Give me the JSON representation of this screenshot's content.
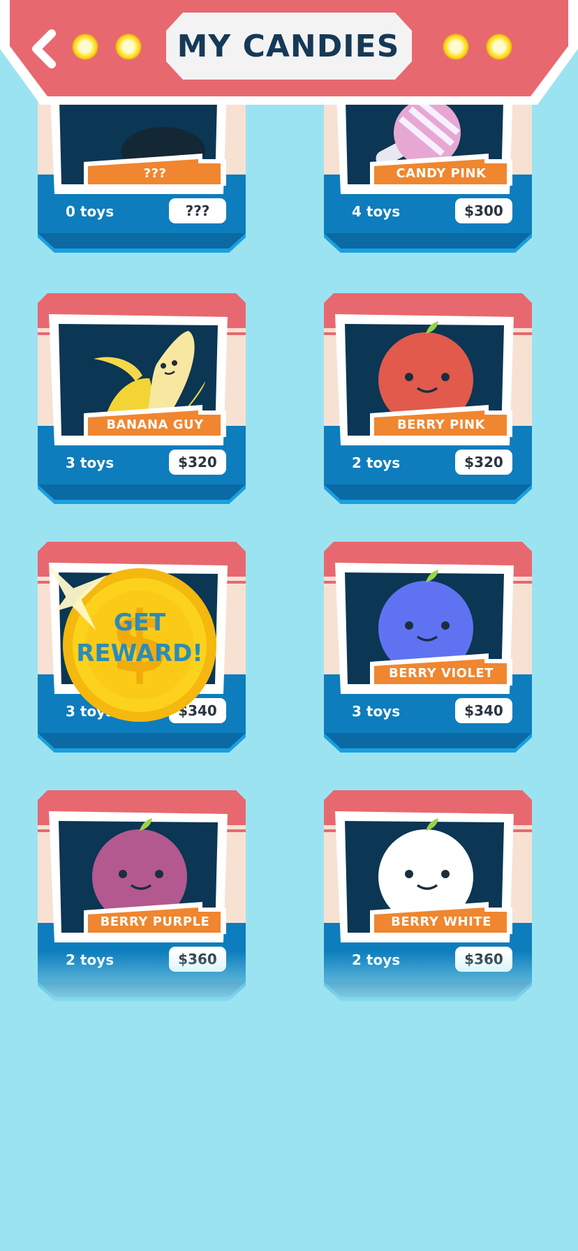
{
  "header": {
    "title": "MY CANDIES",
    "back_icon": "chevron-left-icon",
    "colors": {
      "banner": "#e8686f",
      "plate": "#f2f2f2",
      "title": "#163957",
      "background": "#9ce3f1"
    }
  },
  "reward": {
    "line1": "GET",
    "line2": "REWARD!",
    "icon": "dollar-coin-icon"
  },
  "cards": [
    {
      "name": "???",
      "toys": "0 toys",
      "price": "???",
      "character": "locked-silhouette"
    },
    {
      "name": "CANDY PINK",
      "toys": "4 toys",
      "price": "$300",
      "character": "lollipop-pink"
    },
    {
      "name": "BANANA GUY",
      "toys": "3 toys",
      "price": "$320",
      "character": "banana"
    },
    {
      "name": "BERRY PINK",
      "toys": "2 toys",
      "price": "$320",
      "character": "berry",
      "color": "#e15a4c"
    },
    {
      "name": "",
      "toys": "3 toys",
      "price": "$340",
      "character": "hidden-by-coin"
    },
    {
      "name": "BERRY VIOLET",
      "toys": "3 toys",
      "price": "$340",
      "character": "berry",
      "color": "#5f73f2"
    },
    {
      "name": "BERRY PURPLE",
      "toys": "2 toys",
      "price": "$360",
      "character": "berry",
      "color": "#b3598f"
    },
    {
      "name": "BERRY WHITE",
      "toys": "2 toys",
      "price": "$360",
      "character": "berry",
      "color": "#ffffff"
    }
  ]
}
